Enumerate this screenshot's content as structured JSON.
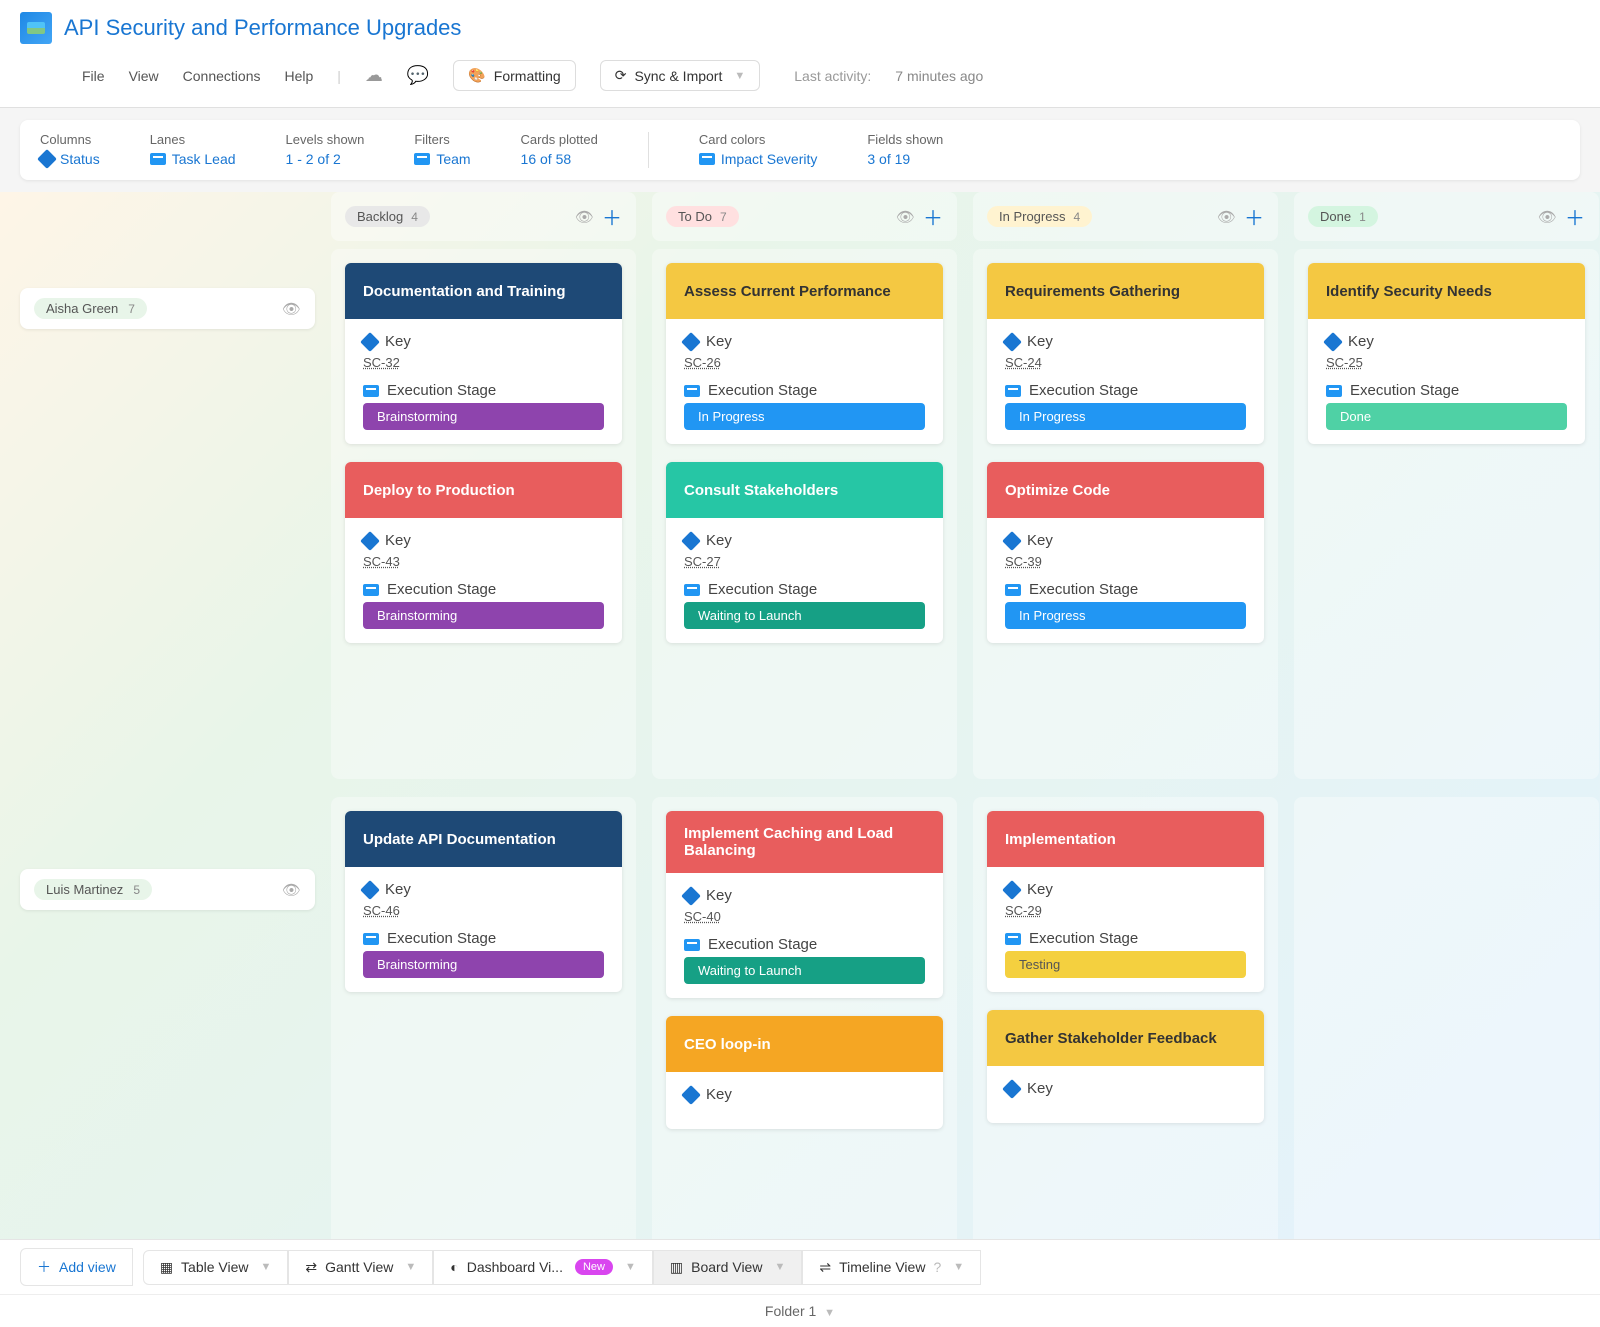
{
  "header": {
    "title": "API Security and Performance Upgrades",
    "menu": [
      "File",
      "View",
      "Connections",
      "Help"
    ],
    "formatting_btn": "Formatting",
    "sync_btn": "Sync & Import",
    "last_activity_label": "Last activity:",
    "last_activity_time": "7 minutes ago"
  },
  "filters": {
    "columns": {
      "label": "Columns",
      "value": "Status"
    },
    "lanes": {
      "label": "Lanes",
      "value": "Task Lead"
    },
    "levels": {
      "label": "Levels shown",
      "value": "1 - 2 of 2"
    },
    "filters": {
      "label": "Filters",
      "value": "Team"
    },
    "cards": {
      "label": "Cards plotted",
      "value": "16 of 58"
    },
    "colors": {
      "label": "Card colors",
      "value": "Impact Severity"
    },
    "fields": {
      "label": "Fields shown",
      "value": "3 of 19"
    }
  },
  "columns": [
    {
      "name": "Backlog",
      "count": "4",
      "pillClass": "col-pill-backlog"
    },
    {
      "name": "To Do",
      "count": "7",
      "pillClass": "col-pill-todo"
    },
    {
      "name": "In Progress",
      "count": "4",
      "pillClass": "col-pill-inprogress"
    },
    {
      "name": "Done",
      "count": "1",
      "pillClass": "col-pill-done"
    }
  ],
  "lanes": [
    {
      "name": "Aisha Green",
      "count": "7"
    },
    {
      "name": "Luis Martinez",
      "count": "5"
    }
  ],
  "field_labels": {
    "key": "Key",
    "stage": "Execution Stage"
  },
  "cards": {
    "r0c0": [
      {
        "title": "Documentation and Training",
        "hdr": "hdr-navy",
        "key": "SC-32",
        "stage": "Brainstorming",
        "stageClass": "stage-purple"
      },
      {
        "title": "Deploy to Production",
        "hdr": "hdr-red",
        "key": "SC-43",
        "stage": "Brainstorming",
        "stageClass": "stage-purple"
      }
    ],
    "r0c1": [
      {
        "title": "Assess Current Performance",
        "hdr": "hdr-yellow",
        "key": "SC-26",
        "stage": "In Progress",
        "stageClass": "stage-blue"
      },
      {
        "title": "Consult Stakeholders",
        "hdr": "hdr-teal",
        "key": "SC-27",
        "stage": "Waiting to Launch",
        "stageClass": "stage-teal"
      }
    ],
    "r0c2": [
      {
        "title": "Requirements Gathering",
        "hdr": "hdr-yellow",
        "key": "SC-24",
        "stage": "In Progress",
        "stageClass": "stage-blue"
      },
      {
        "title": "Optimize Code",
        "hdr": "hdr-red",
        "key": "SC-39",
        "stage": "In Progress",
        "stageClass": "stage-blue"
      }
    ],
    "r0c3": [
      {
        "title": "Identify Security Needs",
        "hdr": "hdr-yellow",
        "key": "SC-25",
        "stage": "Done",
        "stageClass": "stage-green"
      }
    ],
    "r1c0": [
      {
        "title": "Update API Documentation",
        "hdr": "hdr-navy",
        "key": "SC-46",
        "stage": "Brainstorming",
        "stageClass": "stage-purple"
      }
    ],
    "r1c1": [
      {
        "title": "Implement Caching and Load Balancing",
        "hdr": "hdr-red",
        "key": "SC-40",
        "stage": "Waiting to Launch",
        "stageClass": "stage-teal"
      },
      {
        "title": "CEO loop-in",
        "hdr": "hdr-orange",
        "key": "",
        "stage": "",
        "stageClass": "",
        "partial": true
      }
    ],
    "r1c2": [
      {
        "title": "Implementation",
        "hdr": "hdr-red",
        "key": "SC-29",
        "stage": "Testing",
        "stageClass": "stage-yellow"
      },
      {
        "title": "Gather Stakeholder Feedback",
        "hdr": "hdr-yellow",
        "key": "",
        "stage": "",
        "stageClass": "",
        "partial": true
      }
    ],
    "r1c3": []
  },
  "bottom": {
    "add_view": "Add view",
    "tabs": [
      {
        "label": "Table View"
      },
      {
        "label": "Gantt View"
      },
      {
        "label": "Dashboard Vi...",
        "new": true
      },
      {
        "label": "Board View",
        "active": true
      },
      {
        "label": "Timeline View",
        "help": true
      }
    ],
    "new_badge": "New",
    "folder": "Folder 1"
  }
}
